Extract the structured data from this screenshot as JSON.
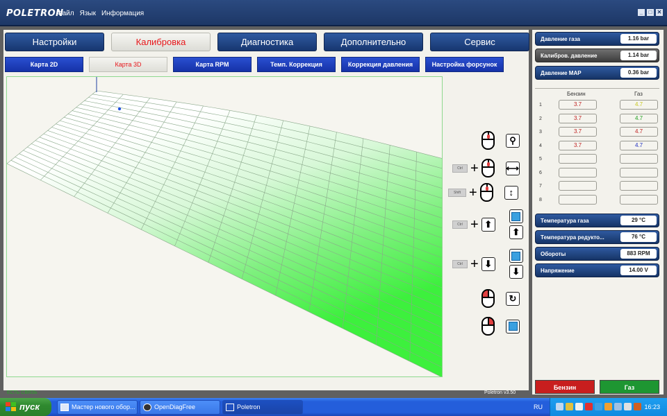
{
  "app": {
    "logo": "POLETRON",
    "menu": [
      "Файл",
      "Язык",
      "Информация"
    ]
  },
  "main_tabs": [
    {
      "label": "Настройки",
      "active": false
    },
    {
      "label": "Калибровка",
      "active": true
    },
    {
      "label": "Диагностика",
      "active": false
    },
    {
      "label": "Дополнительно",
      "active": false
    },
    {
      "label": "Сервис",
      "active": false
    }
  ],
  "sub_tabs": [
    {
      "label": "Карта 2D",
      "active": false
    },
    {
      "label": "Карта 3D",
      "active": true
    },
    {
      "label": "Карта RPM",
      "active": false
    },
    {
      "label": "Темп. Коррекция",
      "active": false
    },
    {
      "label": "Коррекция давления",
      "active": false
    },
    {
      "label": "Настройка форсунок",
      "active": false
    }
  ],
  "tools": {
    "ctrl": "Ctrl",
    "shift": "Shift"
  },
  "readings_top": [
    {
      "label": "Давление газа",
      "value": "1.16 bar",
      "style": "blue"
    },
    {
      "label": "Калибров. давление",
      "value": "1.14 bar",
      "style": "grey"
    },
    {
      "label": "Давление MAP",
      "value": "0.36 bar",
      "style": "blue"
    }
  ],
  "injectors": {
    "petrol_header": "Бензин",
    "gas_header": "Газ",
    "rows": [
      {
        "num": "1",
        "petrol": "3.7",
        "gas": "4.7",
        "gas_color": "#c8c820"
      },
      {
        "num": "2",
        "petrol": "3.7",
        "gas": "4.7",
        "gas_color": "#20a020"
      },
      {
        "num": "3",
        "petrol": "3.7",
        "gas": "4.7",
        "gas_color": "#c02020"
      },
      {
        "num": "4",
        "petrol": "3.7",
        "gas": "4.7",
        "gas_color": "#2030c0"
      },
      {
        "num": "5",
        "petrol": "",
        "gas": "",
        "gas_color": "#333"
      },
      {
        "num": "6",
        "petrol": "",
        "gas": "",
        "gas_color": "#333"
      },
      {
        "num": "7",
        "petrol": "",
        "gas": "",
        "gas_color": "#333"
      },
      {
        "num": "8",
        "petrol": "",
        "gas": "",
        "gas_color": "#333"
      }
    ]
  },
  "readings_bottom": [
    {
      "label": "Температура газа",
      "value": "29 °C"
    },
    {
      "label": "Температура редукто...",
      "value": "76 °C"
    },
    {
      "label": "Обороты",
      "value": "883 RPM"
    },
    {
      "label": "Напряжение",
      "value": "14.00 V"
    }
  ],
  "buttons": {
    "petrol": "Бензин",
    "gas": "Газ",
    "petrol_color": "#c81e1e",
    "gas_color": "#1e9632"
  },
  "status": {
    "connection": "ЕСТЬ СВЯЗЬ",
    "version": "Poletron v3.50"
  },
  "taskbar": {
    "start": "пуск",
    "tasks": [
      {
        "label": "Мастер нового обор...",
        "active": false
      },
      {
        "label": "OpenDiagFree",
        "active": false
      },
      {
        "label": "Poletron",
        "active": true
      }
    ],
    "lang": "RU",
    "time": "16:23"
  }
}
